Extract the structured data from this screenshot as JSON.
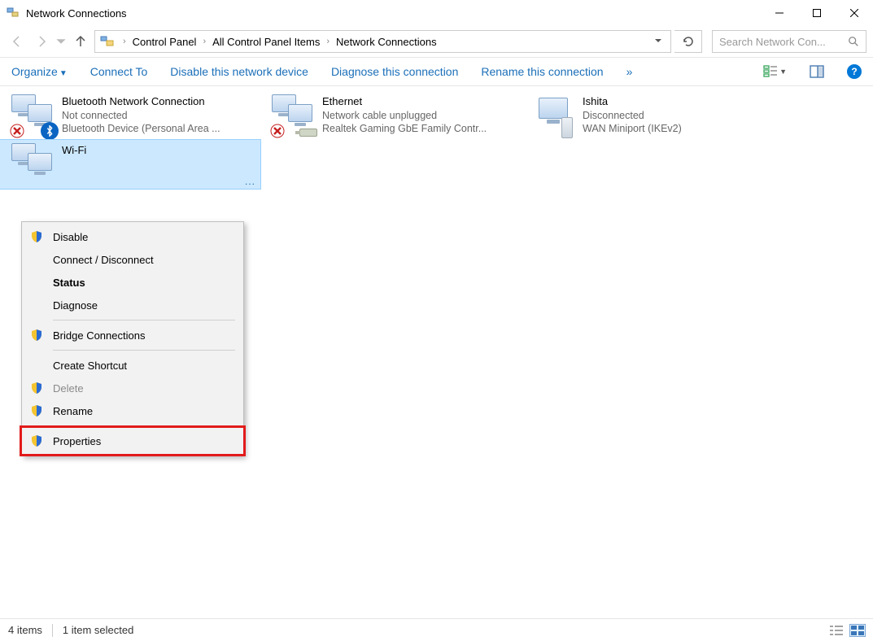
{
  "window": {
    "title": "Network Connections"
  },
  "breadcrumb": {
    "seg1": "Control Panel",
    "seg2": "All Control Panel Items",
    "seg3": "Network Connections"
  },
  "search": {
    "placeholder": "Search Network Con..."
  },
  "toolbar": {
    "organize": "Organize",
    "connect_to": "Connect To",
    "disable": "Disable this network device",
    "diagnose": "Diagnose this connection",
    "rename": "Rename this connection",
    "overflow": "»"
  },
  "connections": {
    "bluetooth": {
      "name": "Bluetooth Network Connection",
      "status": "Not connected",
      "device": "Bluetooth Device (Personal Area ..."
    },
    "ethernet": {
      "name": "Ethernet",
      "status": "Network cable unplugged",
      "device": "Realtek Gaming GbE Family Contr..."
    },
    "ishita": {
      "name": "Ishita",
      "status": "Disconnected",
      "device": "WAN Miniport (IKEv2)"
    },
    "wifi": {
      "name": "Wi-Fi"
    }
  },
  "context_menu": {
    "disable": "Disable",
    "connect": "Connect / Disconnect",
    "status": "Status",
    "diagnose": "Diagnose",
    "bridge": "Bridge Connections",
    "shortcut": "Create Shortcut",
    "delete": "Delete",
    "rename": "Rename",
    "properties": "Properties"
  },
  "statusbar": {
    "count": "4 items",
    "selected": "1 item selected"
  }
}
